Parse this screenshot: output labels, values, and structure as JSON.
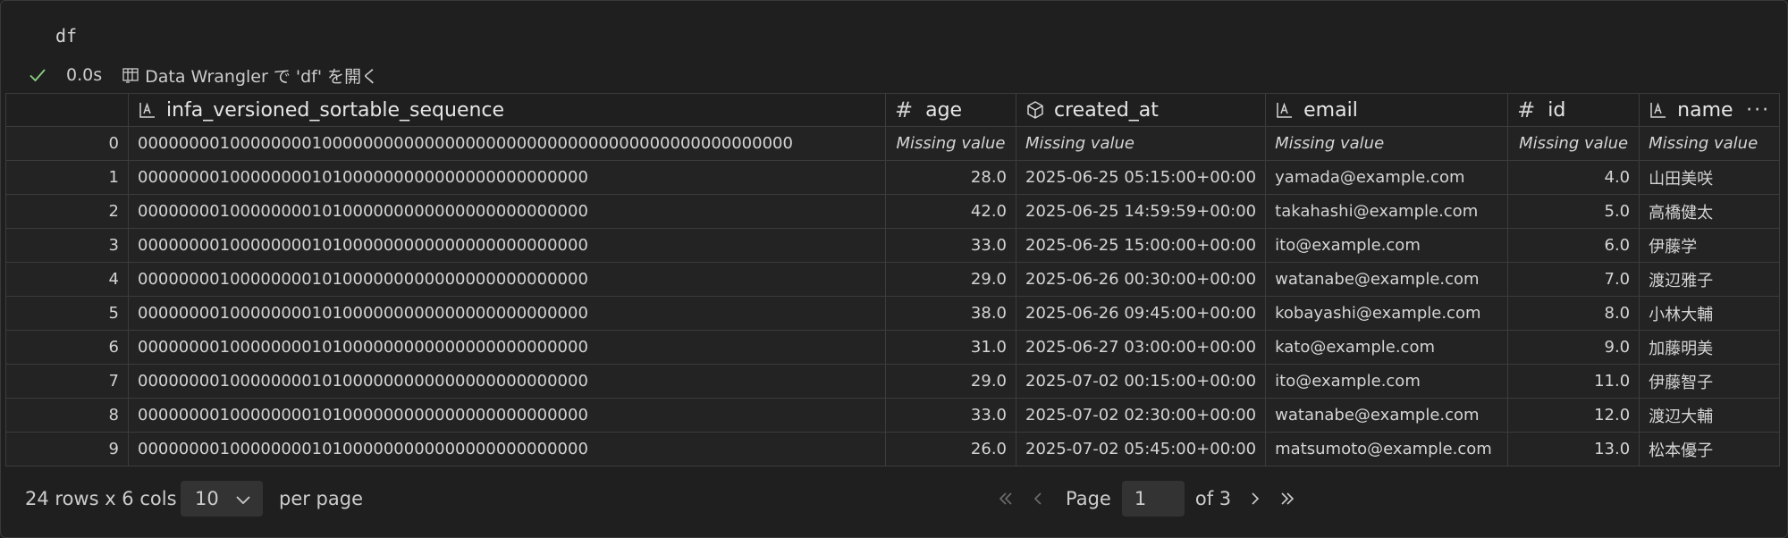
{
  "cell": {
    "code": "df",
    "exec_time": "0.0s",
    "open_in_wrangler": "Data Wrangler で 'df' を開く"
  },
  "table": {
    "columns": [
      {
        "name": "infa_versioned_sortable_sequence",
        "type_icon": "string-icon"
      },
      {
        "name": "age",
        "type_icon": "number-icon"
      },
      {
        "name": "created_at",
        "type_icon": "cube-icon"
      },
      {
        "name": "email",
        "type_icon": "string-icon"
      },
      {
        "name": "id",
        "type_icon": "number-icon"
      },
      {
        "name": "name",
        "type_icon": "string-icon"
      }
    ],
    "more_label": "···",
    "missing_label": "Missing value",
    "rows": [
      {
        "idx": "0",
        "seq": "0000000010000000010000000000000000000000000000000000000000000000",
        "age": "Missing value",
        "created_at": "Missing value",
        "email": "Missing value",
        "id": "Missing value",
        "name": "Missing value"
      },
      {
        "idx": "1",
        "seq": "00000000100000000101000000000000000000000000",
        "age": "28.0",
        "created_at": "2025-06-25 05:15:00+00:00",
        "email": "yamada@example.com",
        "id": "4.0",
        "name": "山田美咲"
      },
      {
        "idx": "2",
        "seq": "00000000100000000101000000000000000000000000",
        "age": "42.0",
        "created_at": "2025-06-25 14:59:59+00:00",
        "email": "takahashi@example.com",
        "id": "5.0",
        "name": "高橋健太"
      },
      {
        "idx": "3",
        "seq": "00000000100000000101000000000000000000000000",
        "age": "33.0",
        "created_at": "2025-06-25 15:00:00+00:00",
        "email": "ito@example.com",
        "id": "6.0",
        "name": "伊藤学"
      },
      {
        "idx": "4",
        "seq": "00000000100000000101000000000000000000000000",
        "age": "29.0",
        "created_at": "2025-06-26 00:30:00+00:00",
        "email": "watanabe@example.com",
        "id": "7.0",
        "name": "渡辺雅子"
      },
      {
        "idx": "5",
        "seq": "00000000100000000101000000000000000000000000",
        "age": "38.0",
        "created_at": "2025-06-26 09:45:00+00:00",
        "email": "kobayashi@example.com",
        "id": "8.0",
        "name": "小林大輔"
      },
      {
        "idx": "6",
        "seq": "00000000100000000101000000000000000000000000",
        "age": "31.0",
        "created_at": "2025-06-27 03:00:00+00:00",
        "email": "kato@example.com",
        "id": "9.0",
        "name": "加藤明美"
      },
      {
        "idx": "7",
        "seq": "00000000100000000101000000000000000000000000",
        "age": "29.0",
        "created_at": "2025-07-02 00:15:00+00:00",
        "email": "ito@example.com",
        "id": "11.0",
        "name": "伊藤智子"
      },
      {
        "idx": "8",
        "seq": "00000000100000000101000000000000000000000000",
        "age": "33.0",
        "created_at": "2025-07-02 02:30:00+00:00",
        "email": "watanabe@example.com",
        "id": "12.0",
        "name": "渡辺大輔"
      },
      {
        "idx": "9",
        "seq": "00000000100000000101000000000000000000000000",
        "age": "26.0",
        "created_at": "2025-07-02 05:45:00+00:00",
        "email": "matsumoto@example.com",
        "id": "13.0",
        "name": "松本優子"
      }
    ]
  },
  "footer": {
    "rows_cols": "24 rows x 6 cols",
    "page_size": "10",
    "per_page": "per page",
    "page_label": "Page",
    "current_page": "1",
    "of_pages": "of 3"
  },
  "colors": {
    "success": "#89d185",
    "selected_header": "#4b4b3c",
    "missing_text": "#7f7f7f"
  }
}
